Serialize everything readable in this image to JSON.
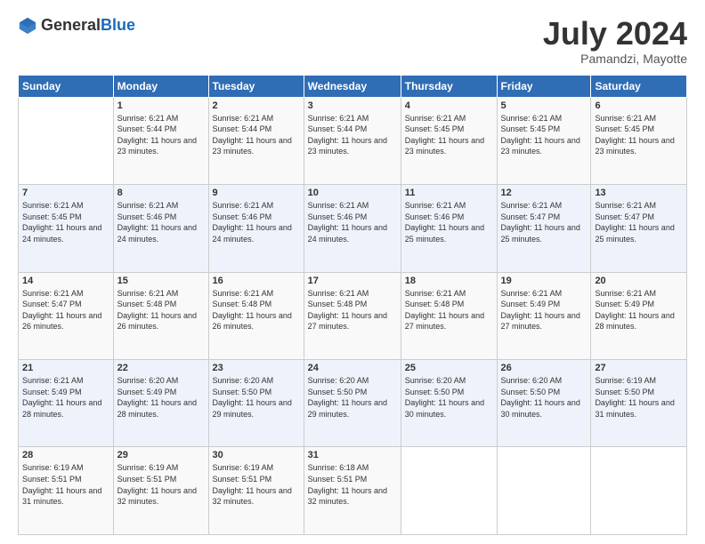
{
  "logo": {
    "general": "General",
    "blue": "Blue"
  },
  "header": {
    "month": "July 2024",
    "location": "Pamandzi, Mayotte"
  },
  "weekdays": [
    "Sunday",
    "Monday",
    "Tuesday",
    "Wednesday",
    "Thursday",
    "Friday",
    "Saturday"
  ],
  "weeks": [
    [
      {
        "day": "",
        "sunrise": "",
        "sunset": "",
        "daylight": ""
      },
      {
        "day": "1",
        "sunrise": "Sunrise: 6:21 AM",
        "sunset": "Sunset: 5:44 PM",
        "daylight": "Daylight: 11 hours and 23 minutes."
      },
      {
        "day": "2",
        "sunrise": "Sunrise: 6:21 AM",
        "sunset": "Sunset: 5:44 PM",
        "daylight": "Daylight: 11 hours and 23 minutes."
      },
      {
        "day": "3",
        "sunrise": "Sunrise: 6:21 AM",
        "sunset": "Sunset: 5:44 PM",
        "daylight": "Daylight: 11 hours and 23 minutes."
      },
      {
        "day": "4",
        "sunrise": "Sunrise: 6:21 AM",
        "sunset": "Sunset: 5:45 PM",
        "daylight": "Daylight: 11 hours and 23 minutes."
      },
      {
        "day": "5",
        "sunrise": "Sunrise: 6:21 AM",
        "sunset": "Sunset: 5:45 PM",
        "daylight": "Daylight: 11 hours and 23 minutes."
      },
      {
        "day": "6",
        "sunrise": "Sunrise: 6:21 AM",
        "sunset": "Sunset: 5:45 PM",
        "daylight": "Daylight: 11 hours and 23 minutes."
      }
    ],
    [
      {
        "day": "7",
        "sunrise": "Sunrise: 6:21 AM",
        "sunset": "Sunset: 5:45 PM",
        "daylight": "Daylight: 11 hours and 24 minutes."
      },
      {
        "day": "8",
        "sunrise": "Sunrise: 6:21 AM",
        "sunset": "Sunset: 5:46 PM",
        "daylight": "Daylight: 11 hours and 24 minutes."
      },
      {
        "day": "9",
        "sunrise": "Sunrise: 6:21 AM",
        "sunset": "Sunset: 5:46 PM",
        "daylight": "Daylight: 11 hours and 24 minutes."
      },
      {
        "day": "10",
        "sunrise": "Sunrise: 6:21 AM",
        "sunset": "Sunset: 5:46 PM",
        "daylight": "Daylight: 11 hours and 24 minutes."
      },
      {
        "day": "11",
        "sunrise": "Sunrise: 6:21 AM",
        "sunset": "Sunset: 5:46 PM",
        "daylight": "Daylight: 11 hours and 25 minutes."
      },
      {
        "day": "12",
        "sunrise": "Sunrise: 6:21 AM",
        "sunset": "Sunset: 5:47 PM",
        "daylight": "Daylight: 11 hours and 25 minutes."
      },
      {
        "day": "13",
        "sunrise": "Sunrise: 6:21 AM",
        "sunset": "Sunset: 5:47 PM",
        "daylight": "Daylight: 11 hours and 25 minutes."
      }
    ],
    [
      {
        "day": "14",
        "sunrise": "Sunrise: 6:21 AM",
        "sunset": "Sunset: 5:47 PM",
        "daylight": "Daylight: 11 hours and 26 minutes."
      },
      {
        "day": "15",
        "sunrise": "Sunrise: 6:21 AM",
        "sunset": "Sunset: 5:48 PM",
        "daylight": "Daylight: 11 hours and 26 minutes."
      },
      {
        "day": "16",
        "sunrise": "Sunrise: 6:21 AM",
        "sunset": "Sunset: 5:48 PM",
        "daylight": "Daylight: 11 hours and 26 minutes."
      },
      {
        "day": "17",
        "sunrise": "Sunrise: 6:21 AM",
        "sunset": "Sunset: 5:48 PM",
        "daylight": "Daylight: 11 hours and 27 minutes."
      },
      {
        "day": "18",
        "sunrise": "Sunrise: 6:21 AM",
        "sunset": "Sunset: 5:48 PM",
        "daylight": "Daylight: 11 hours and 27 minutes."
      },
      {
        "day": "19",
        "sunrise": "Sunrise: 6:21 AM",
        "sunset": "Sunset: 5:49 PM",
        "daylight": "Daylight: 11 hours and 27 minutes."
      },
      {
        "day": "20",
        "sunrise": "Sunrise: 6:21 AM",
        "sunset": "Sunset: 5:49 PM",
        "daylight": "Daylight: 11 hours and 28 minutes."
      }
    ],
    [
      {
        "day": "21",
        "sunrise": "Sunrise: 6:21 AM",
        "sunset": "Sunset: 5:49 PM",
        "daylight": "Daylight: 11 hours and 28 minutes."
      },
      {
        "day": "22",
        "sunrise": "Sunrise: 6:20 AM",
        "sunset": "Sunset: 5:49 PM",
        "daylight": "Daylight: 11 hours and 28 minutes."
      },
      {
        "day": "23",
        "sunrise": "Sunrise: 6:20 AM",
        "sunset": "Sunset: 5:50 PM",
        "daylight": "Daylight: 11 hours and 29 minutes."
      },
      {
        "day": "24",
        "sunrise": "Sunrise: 6:20 AM",
        "sunset": "Sunset: 5:50 PM",
        "daylight": "Daylight: 11 hours and 29 minutes."
      },
      {
        "day": "25",
        "sunrise": "Sunrise: 6:20 AM",
        "sunset": "Sunset: 5:50 PM",
        "daylight": "Daylight: 11 hours and 30 minutes."
      },
      {
        "day": "26",
        "sunrise": "Sunrise: 6:20 AM",
        "sunset": "Sunset: 5:50 PM",
        "daylight": "Daylight: 11 hours and 30 minutes."
      },
      {
        "day": "27",
        "sunrise": "Sunrise: 6:19 AM",
        "sunset": "Sunset: 5:50 PM",
        "daylight": "Daylight: 11 hours and 31 minutes."
      }
    ],
    [
      {
        "day": "28",
        "sunrise": "Sunrise: 6:19 AM",
        "sunset": "Sunset: 5:51 PM",
        "daylight": "Daylight: 11 hours and 31 minutes."
      },
      {
        "day": "29",
        "sunrise": "Sunrise: 6:19 AM",
        "sunset": "Sunset: 5:51 PM",
        "daylight": "Daylight: 11 hours and 32 minutes."
      },
      {
        "day": "30",
        "sunrise": "Sunrise: 6:19 AM",
        "sunset": "Sunset: 5:51 PM",
        "daylight": "Daylight: 11 hours and 32 minutes."
      },
      {
        "day": "31",
        "sunrise": "Sunrise: 6:18 AM",
        "sunset": "Sunset: 5:51 PM",
        "daylight": "Daylight: 11 hours and 32 minutes."
      },
      {
        "day": "",
        "sunrise": "",
        "sunset": "",
        "daylight": ""
      },
      {
        "day": "",
        "sunrise": "",
        "sunset": "",
        "daylight": ""
      },
      {
        "day": "",
        "sunrise": "",
        "sunset": "",
        "daylight": ""
      }
    ]
  ]
}
